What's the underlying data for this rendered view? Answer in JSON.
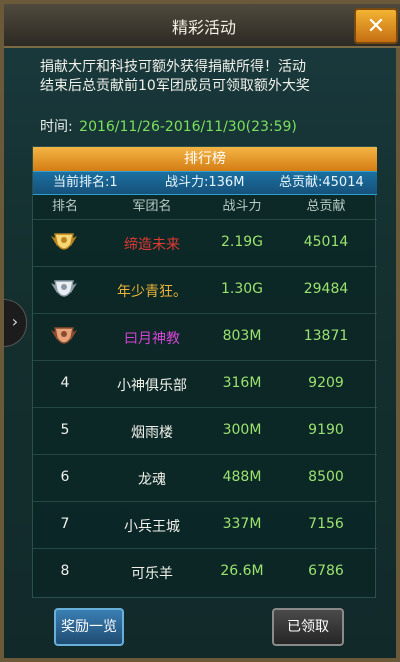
{
  "window": {
    "title": "精彩活动",
    "close_icon": "close-icon"
  },
  "description": {
    "line1": "捐献大厅和科技可额外获得捐献所得！活动",
    "line2": "结束后总贡献前10军团成员可领取额外大奖"
  },
  "time": {
    "label": "时间:",
    "value": "2016/11/26-2016/11/30(23:59)"
  },
  "leaderboard": {
    "title": "排行榜",
    "summary": {
      "rank": "当前排名:1",
      "power": "战斗力:136M",
      "contribution": "总贡献:45014"
    },
    "columns": [
      "排名",
      "军团名",
      "战斗力",
      "总贡献"
    ],
    "rows": [
      {
        "rank": "",
        "medal": "gold",
        "name": "缔造未来",
        "name_color": "#e23a32",
        "power": "2.19G",
        "contribution": "45014"
      },
      {
        "rank": "",
        "medal": "silver",
        "name": "年少青狂。",
        "name_color": "#e9b33b",
        "power": "1.30G",
        "contribution": "29484"
      },
      {
        "rank": "",
        "medal": "bronze",
        "name": "曰月神教",
        "name_color": "#d444d6",
        "power": "803M",
        "contribution": "13871"
      },
      {
        "rank": "4",
        "medal": "",
        "name": "小神俱乐部",
        "name_color": "#f1f1ea",
        "power": "316M",
        "contribution": "9209"
      },
      {
        "rank": "5",
        "medal": "",
        "name": "烟雨楼",
        "name_color": "#f1f1ea",
        "power": "300M",
        "contribution": "9190"
      },
      {
        "rank": "6",
        "medal": "",
        "name": "龙魂",
        "name_color": "#f1f1ea",
        "power": "488M",
        "contribution": "8500"
      },
      {
        "rank": "7",
        "medal": "",
        "name": "小兵王城",
        "name_color": "#f1f1ea",
        "power": "337M",
        "contribution": "7156"
      },
      {
        "rank": "8",
        "medal": "",
        "name": "可乐羊",
        "name_color": "#f1f1ea",
        "power": "26.6M",
        "contribution": "6786"
      }
    ]
  },
  "buttons": {
    "rewards": "奖励一览",
    "claimed": "已领取"
  },
  "colors": {
    "accent_orange": "#f4b545",
    "summary_blue": "#1b6fa0",
    "value_green": "#9be36f"
  }
}
